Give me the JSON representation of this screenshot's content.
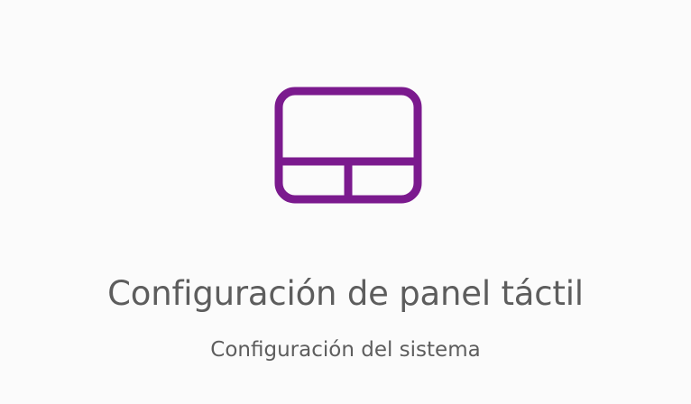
{
  "tile": {
    "icon": "touchpad-icon",
    "icon_color": "#7b1a8e",
    "title": "Configuración de panel táctil",
    "subtitle": "Configuración del sistema"
  }
}
